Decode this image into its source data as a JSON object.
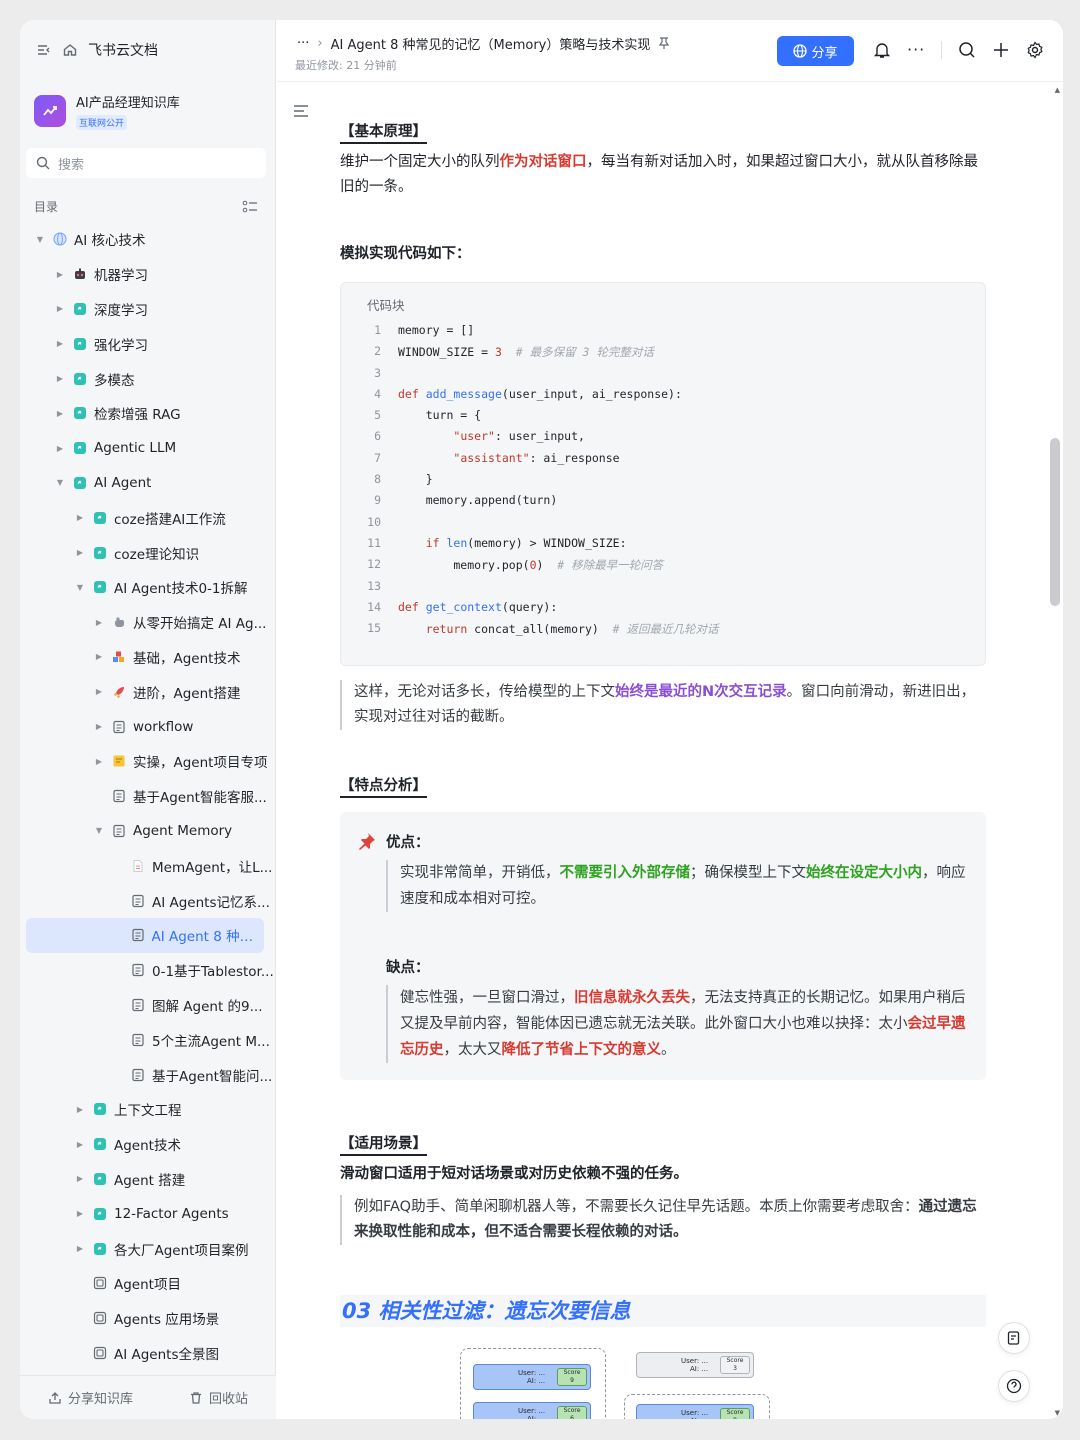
{
  "app": {
    "name": "飞书云文档"
  },
  "knowledge_base": {
    "name": "AI产品经理知识库",
    "badge": "互联网公开"
  },
  "search": {
    "placeholder": "搜索"
  },
  "toc": {
    "label": "目录"
  },
  "tree": [
    {
      "label": "AI 核心技术",
      "depth": 0,
      "caret": "down",
      "icon": "globe-icon"
    },
    {
      "label": "机器学习",
      "depth": 1,
      "caret": "right",
      "icon": "robot-icon"
    },
    {
      "label": "深度学习",
      "depth": 1,
      "caret": "right",
      "icon": "doc-link-icon"
    },
    {
      "label": "强化学习",
      "depth": 1,
      "caret": "right",
      "icon": "doc-link-icon"
    },
    {
      "label": "多模态",
      "depth": 1,
      "caret": "right",
      "icon": "doc-link-icon"
    },
    {
      "label": "检索增强 RAG",
      "depth": 1,
      "caret": "right",
      "icon": "doc-link-icon"
    },
    {
      "label": "Agentic LLM",
      "depth": 1,
      "caret": "right",
      "icon": "doc-link-icon"
    },
    {
      "label": "AI Agent",
      "depth": 1,
      "caret": "down",
      "icon": "doc-link-icon"
    },
    {
      "label": "coze搭建AI工作流",
      "depth": 2,
      "caret": "right",
      "icon": "doc-link-icon"
    },
    {
      "label": "coze理论知识",
      "depth": 2,
      "caret": "right",
      "icon": "doc-link-icon"
    },
    {
      "label": "AI Agent技术0-1拆解",
      "depth": 2,
      "caret": "down",
      "icon": "doc-link-icon"
    },
    {
      "label": "从零开始搞定 AI Ag...",
      "depth": 3,
      "caret": "right",
      "icon": "hand-icon"
    },
    {
      "label": "基础，Agent技术",
      "depth": 3,
      "caret": "right",
      "icon": "blocks-icon"
    },
    {
      "label": "进阶，Agent搭建",
      "depth": 3,
      "caret": "right",
      "icon": "rocket-icon"
    },
    {
      "label": "workflow",
      "depth": 3,
      "caret": "right",
      "icon": "doc-icon"
    },
    {
      "label": "实操，Agent项目专项",
      "depth": 3,
      "caret": "right",
      "icon": "note-icon"
    },
    {
      "label": "基于Agent智能客服...",
      "depth": 3,
      "caret": "",
      "icon": "doc-icon"
    },
    {
      "label": "Agent Memory",
      "depth": 3,
      "caret": "down",
      "icon": "doc-icon"
    },
    {
      "label": "MemAgent，让L...",
      "depth": 4,
      "caret": "",
      "icon": "page-icon"
    },
    {
      "label": "AI Agents记忆系...",
      "depth": 4,
      "caret": "",
      "icon": "doc-icon"
    },
    {
      "label": "AI Agent 8 种常...",
      "depth": 4,
      "caret": "",
      "icon": "doc-icon",
      "active": true
    },
    {
      "label": "0-1基于Tablestor...",
      "depth": 4,
      "caret": "",
      "icon": "doc-icon"
    },
    {
      "label": "图解 Agent 的9...",
      "depth": 4,
      "caret": "",
      "icon": "doc-icon"
    },
    {
      "label": "5个主流Agent M...",
      "depth": 4,
      "caret": "",
      "icon": "doc-icon"
    },
    {
      "label": "基于Agent智能问...",
      "depth": 4,
      "caret": "",
      "icon": "doc-icon"
    },
    {
      "label": "上下文工程",
      "depth": 2,
      "caret": "right",
      "icon": "doc-link-icon"
    },
    {
      "label": "Agent技术",
      "depth": 2,
      "caret": "right",
      "icon": "doc-link-icon"
    },
    {
      "label": "Agent 搭建",
      "depth": 2,
      "caret": "right",
      "icon": "doc-link-icon"
    },
    {
      "label": "12-Factor Agents",
      "depth": 2,
      "caret": "right",
      "icon": "doc-link-icon"
    },
    {
      "label": "各大厂Agent项目案例",
      "depth": 2,
      "caret": "right",
      "icon": "doc-link-icon"
    },
    {
      "label": "Agent项目",
      "depth": 2,
      "caret": "",
      "icon": "board-icon"
    },
    {
      "label": "Agents 应用场景",
      "depth": 2,
      "caret": "",
      "icon": "board-icon"
    },
    {
      "label": "AI Agents全景图",
      "depth": 2,
      "caret": "",
      "icon": "board-icon"
    }
  ],
  "footer": {
    "share_kb": "分享知识库",
    "recycle": "回收站"
  },
  "header": {
    "breadcrumb_more": "···",
    "doc_title": "AI Agent 8 种常见的记忆（Memory）策略与技术实现",
    "modified": "最近修改: 21 分钟前",
    "share_label": "分享"
  },
  "doc": {
    "sec1_title": "【基本原理】",
    "p1_a": "维护一个固定大小的队列",
    "p1_b": "作为对话窗口",
    "p1_c": "，每当有新对话加入时，如果超过窗口大小，就从队首移除最旧的一条。",
    "code_heading": "模拟实现代码如下：",
    "code_title": "代码块",
    "quote1_a": "这样，无论对话多长，传给模型的上下文",
    "quote1_b": "始终是最近的N次交互记录",
    "quote1_c": "。窗口向前滑动，新进旧出，实现对过往对话的截断。",
    "sec2_title": "【特点分析】",
    "pros_label": "优点：",
    "pros_a": "实现非常简单，开销低，",
    "pros_b": "不需要引入外部存储",
    "pros_c": "；确保模型上下文",
    "pros_d": "始终在设定大小内",
    "pros_e": "，响应速度和成本相对可控。",
    "cons_label": "缺点：",
    "cons_a": "健忘性强，一旦窗口滑过，",
    "cons_b": "旧信息就永久丢失",
    "cons_c": "，无法支持真正的长期记忆。如果用户稍后又提及早前内容，智能体因已遗忘就无法关联。此外窗口大小也难以抉择：太小",
    "cons_d": "会过早遗忘历史",
    "cons_e": "，太大又",
    "cons_f": "降低了节省上下文的意义",
    "cons_g": "。",
    "sec3_title": "【适用场景】",
    "scene_heading": "滑动窗口适用于短对话场景或对历史依赖不强的任务。",
    "quote2_a": "例如FAQ助手、简单闲聊机器人等，不需要长久记住早先话题。本质上你需要考虑取舍：",
    "quote2_b": "通过遗忘来换取性能和成本，但不适合需要长程依赖的对话。",
    "h3": "03 相关性过滤：遗忘次要信息"
  },
  "diagram": {
    "user_text": "User: ...",
    "ai_text": "AI: ...",
    "score_label": "Score",
    "scores": [
      "9",
      "6",
      "3",
      "9"
    ]
  }
}
